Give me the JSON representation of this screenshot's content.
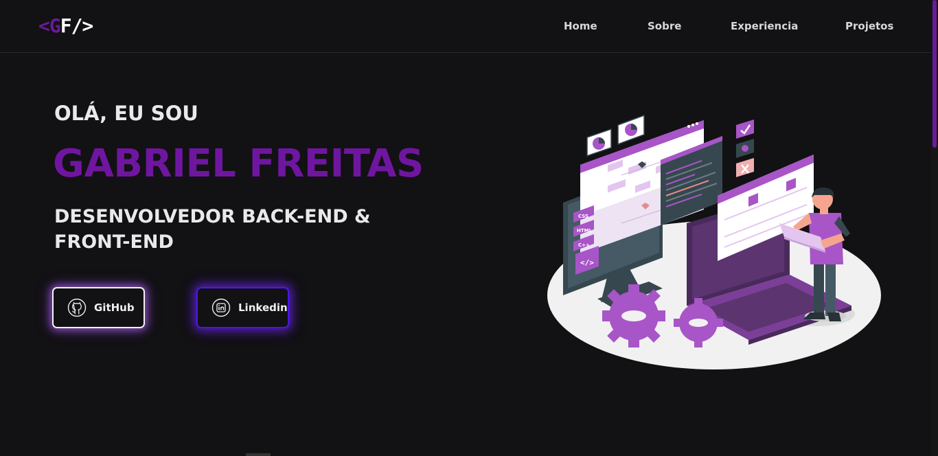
{
  "nav": {
    "logo": {
      "open": "<",
      "g": "G",
      "rest": "F/>"
    },
    "items": [
      {
        "label": "Home"
      },
      {
        "label": "Sobre"
      },
      {
        "label": "Experiencia"
      },
      {
        "label": "Projetos"
      }
    ]
  },
  "hero": {
    "greeting": "OLÁ, EU SOU",
    "name": "GABRIEL FREITAS",
    "role": "DESENVOLVEDOR BACK-END & FRONT-END"
  },
  "buttons": {
    "github": {
      "label": "GitHub",
      "icon": "github-icon"
    },
    "linkedin": {
      "label": "Linkedin",
      "icon": "linkedin-icon"
    }
  },
  "illustration": {
    "badges": [
      "CSS",
      "HTML",
      "C++"
    ]
  },
  "colors": {
    "background": "#121113",
    "accent": "#6f16a0",
    "illustration_purple": "#a855c7",
    "text": "#e9e9ea"
  }
}
